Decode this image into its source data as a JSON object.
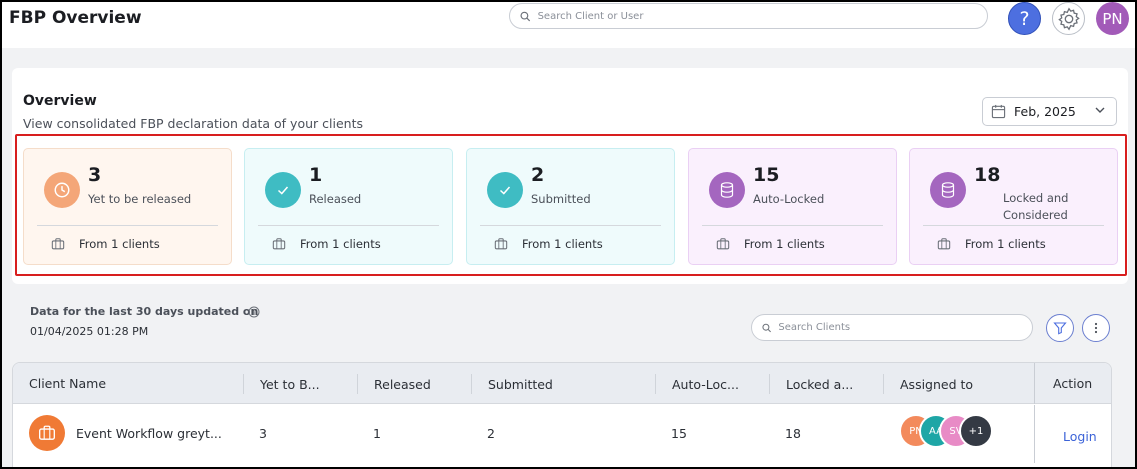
{
  "header": {
    "title": "FBP Overview",
    "search_placeholder": "Search Client or User",
    "help_label": "?",
    "user_initials": "PN"
  },
  "overview": {
    "title": "Overview",
    "subtitle": "View consolidated FBP declaration data of your clients",
    "date": "Feb, 2025",
    "cards": [
      {
        "count": "3",
        "label": "Yet to be released",
        "footer": "From 1 clients",
        "icon": "clock-icon",
        "accent": "#f4a678",
        "bg": "#fff6ef",
        "border": "#f5ddca"
      },
      {
        "count": "1",
        "label": "Released",
        "footer": "From 1 clients",
        "icon": "check-icon",
        "accent": "#3fbcc3",
        "bg": "#effbfc",
        "border": "#c7eef1"
      },
      {
        "count": "2",
        "label": "Submitted",
        "footer": "From 1 clients",
        "icon": "check-icon",
        "accent": "#3fbcc3",
        "bg": "#effbfc",
        "border": "#c7eef1"
      },
      {
        "count": "15",
        "label": "Auto-Locked",
        "footer": "From 1 clients",
        "icon": "database-icon",
        "accent": "#a466bf",
        "bg": "#faf0fd",
        "border": "#ead0f4"
      },
      {
        "count": "18",
        "label": "Locked and\nConsidered",
        "footer": "From 1 clients",
        "icon": "database-icon",
        "accent": "#a466bf",
        "bg": "#faf0fd",
        "border": "#ead0f4"
      }
    ]
  },
  "data_section": {
    "updated_line1": "Data for the last 30 days updated on",
    "updated_line2": "01/04/2025 01:28 PM",
    "search_placeholder": "Search Clients"
  },
  "table": {
    "columns": [
      "Client Name",
      "Yet to B...",
      "Released",
      "Submitted",
      "Auto-Loc...",
      "Locked a...",
      "Assigned to",
      "Action"
    ],
    "rows": [
      {
        "client": "Event Workflow greyt...",
        "yet": "3",
        "released": "1",
        "submitted": "2",
        "auto_locked": "15",
        "locked": "18",
        "assignees": [
          {
            "initials": "PN",
            "color": "#f38a5c"
          },
          {
            "initials": "AA",
            "color": "#1ea6a6"
          },
          {
            "initials": "SV",
            "color": "#e88bc6"
          },
          {
            "initials": "+1",
            "color": "#343a44"
          }
        ],
        "action": "Login"
      }
    ]
  }
}
